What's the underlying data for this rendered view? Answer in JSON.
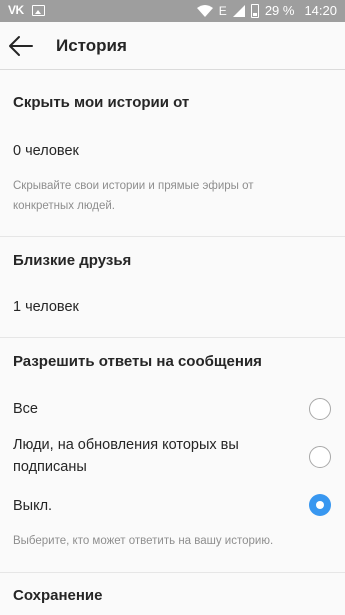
{
  "status_bar": {
    "vk_label": "VK",
    "battery": "29 %",
    "time": "14:20",
    "network": "E"
  },
  "header": {
    "title": "История"
  },
  "hide_story": {
    "title": "Скрыть мои истории от",
    "count": "0 человек",
    "hint": "Скрывайте свои истории и прямые эфиры от конкретных людей."
  },
  "close_friends": {
    "title": "Близкие друзья",
    "count": "1 человек"
  },
  "replies": {
    "title": "Разрешить ответы на сообщения",
    "options": [
      {
        "label": "Все",
        "selected": false
      },
      {
        "label": "Люди, на обновления которых вы подписаны",
        "selected": false
      },
      {
        "label": "Выкл.",
        "selected": true
      }
    ],
    "hint": "Выберите, кто может ответить на вашу историю."
  },
  "saving": {
    "title": "Сохранение"
  },
  "colors": {
    "accent": "#3897f0",
    "status_bar": "#9e9e9e"
  }
}
